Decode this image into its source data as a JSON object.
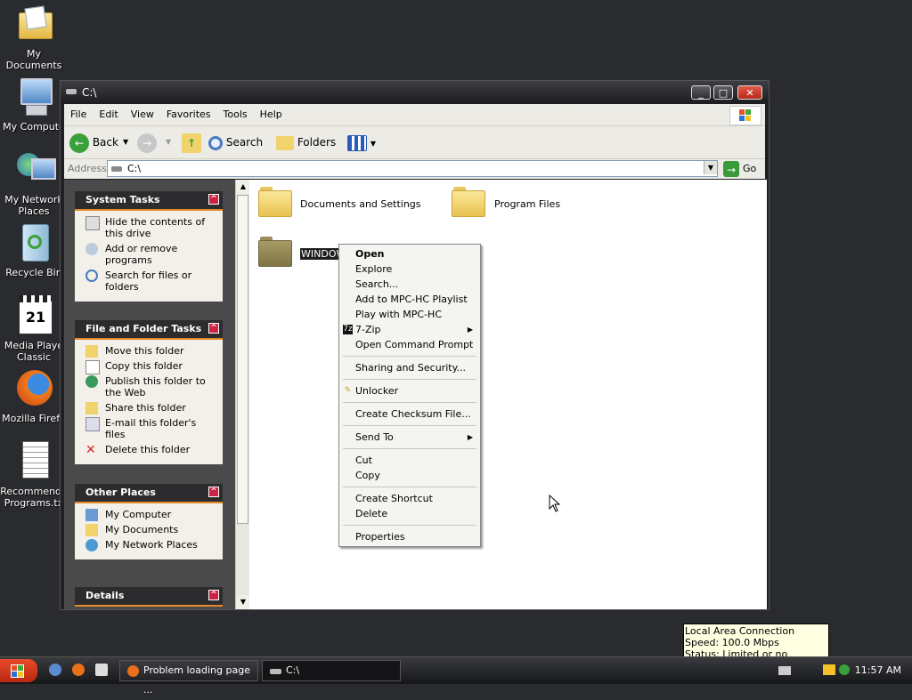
{
  "desktop": {
    "icons": [
      {
        "label": "My Documents",
        "icon": "my-documents-icon"
      },
      {
        "label": "My Compute",
        "icon": "my-computer-icon"
      },
      {
        "label": "My Network\nPlaces",
        "icon": "network-places-icon"
      },
      {
        "label": "Recycle Bin",
        "icon": "recycle-bin-icon"
      },
      {
        "label": "Media Playe\nClassic",
        "icon": "media-player-classic-icon"
      },
      {
        "label": "Mozilla Firefo",
        "icon": "firefox-icon"
      },
      {
        "label": "Recommende\nPrograms.tx",
        "icon": "text-file-icon"
      }
    ]
  },
  "window": {
    "title": "C:\\",
    "menu": [
      "File",
      "Edit",
      "View",
      "Favorites",
      "Tools",
      "Help"
    ],
    "toolbar": {
      "back": "Back",
      "search": "Search",
      "folders": "Folders"
    },
    "address": {
      "label": "Address",
      "value": "C:\\",
      "go": "Go"
    }
  },
  "left_pane": {
    "system_tasks": {
      "title": "System Tasks",
      "items": [
        "Hide the contents of this drive",
        "Add or remove programs",
        "Search for files or folders"
      ]
    },
    "file_folder_tasks": {
      "title": "File and Folder Tasks",
      "items": [
        "Move this folder",
        "Copy this folder",
        "Publish this folder to the Web",
        "Share this folder",
        "E-mail this folder's files",
        "Delete this folder"
      ]
    },
    "other_places": {
      "title": "Other Places",
      "items": [
        "My Computer",
        "My Documents",
        "My Network Places"
      ]
    },
    "details": {
      "title": "Details"
    }
  },
  "content": {
    "folders": [
      "Documents and Settings",
      "Program Files",
      "WINDOW"
    ]
  },
  "context_menu": {
    "items": [
      "Open",
      "Explore",
      "Search...",
      "Add to MPC-HC Playlist",
      "Play with MPC-HC",
      "7-Zip",
      "Open Command Prompt",
      "Sharing and Security...",
      "Unlocker",
      "Create Checksum File...",
      "Send To",
      "Cut",
      "Copy",
      "Create Shortcut",
      "Delete",
      "Properties"
    ]
  },
  "taskbar": {
    "tasks": [
      "Problem loading page ...",
      "C:\\"
    ],
    "clock": "11:57 AM"
  },
  "tooltip": {
    "line1": "Local Area Connection",
    "line2": "Speed: 100.0 Mbps",
    "line3": "Status: Limited or no connectivity"
  }
}
